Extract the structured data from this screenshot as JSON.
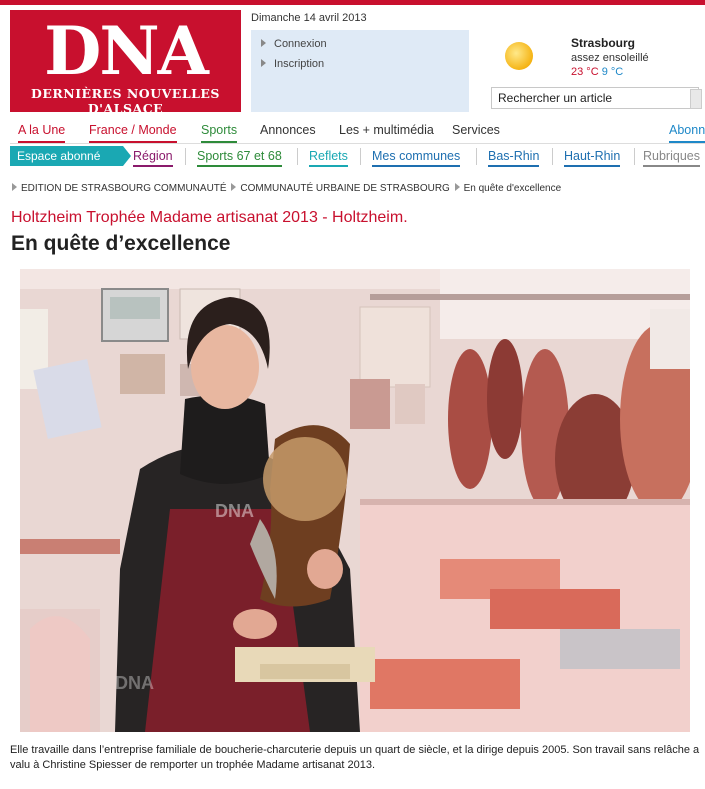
{
  "logo": {
    "title": "DNA",
    "subtitle": "DERNIÈRES NOUVELLES D'ALSACE"
  },
  "date": "Dimanche 14 avril 2013",
  "account": {
    "login": "Connexion",
    "register": "Inscription"
  },
  "weather": {
    "city": "Strasbourg",
    "description": "assez ensoleillé",
    "temp_max": "23 °C",
    "temp_min": "9 °C",
    "icon": "sun-icon"
  },
  "search": {
    "value": "Rechercher un article"
  },
  "main_nav": [
    {
      "label": "A la Une",
      "color": "#c8102e"
    },
    {
      "label": "France / Monde",
      "color": "#c8102e"
    },
    {
      "label": "Sports",
      "color": "#2e8b3a"
    },
    {
      "label": "Annonces",
      "color": "#333333"
    },
    {
      "label": "Les + multimédia",
      "color": "#333333"
    },
    {
      "label": "Services",
      "color": "#333333"
    },
    {
      "label": "Abonn",
      "color": "#1e88c8"
    }
  ],
  "sub_nav": {
    "espace": "Espace abonné",
    "items": [
      {
        "label": "Région",
        "color": "#8a1a6b"
      },
      {
        "label": "Sports 67 et 68",
        "color": "#2e8b3a"
      },
      {
        "label": "Reflets",
        "color": "#1aa8b3"
      },
      {
        "label": "Mes communes",
        "color": "#1e6fb0"
      },
      {
        "label": "Bas-Rhin",
        "color": "#1e6fb0"
      },
      {
        "label": "Haut-Rhin",
        "color": "#1e6fb0"
      },
      {
        "label": "Rubriques",
        "color": "#888888"
      }
    ]
  },
  "breadcrumb": [
    "EDITION DE STRASBOURG COMMUNAUTÉ",
    "COMMUNAUTÉ URBAINE DE STRASBOURG",
    "En quête d'excellence"
  ],
  "article": {
    "kicker": "Holtzheim Trophée Madame artisanat 2013 - Holtzheim.",
    "title": "En quête d’excellence",
    "caption": "Elle travaille dans l’entreprise familiale de boucherie-charcuterie depuis un quart de siècle, et la dirige depuis 2005. Son travail sans relâche a valu à Christine Spiesser de remporter un trophée Madame artisanat 2013.",
    "photo_watermark": "DNA"
  }
}
